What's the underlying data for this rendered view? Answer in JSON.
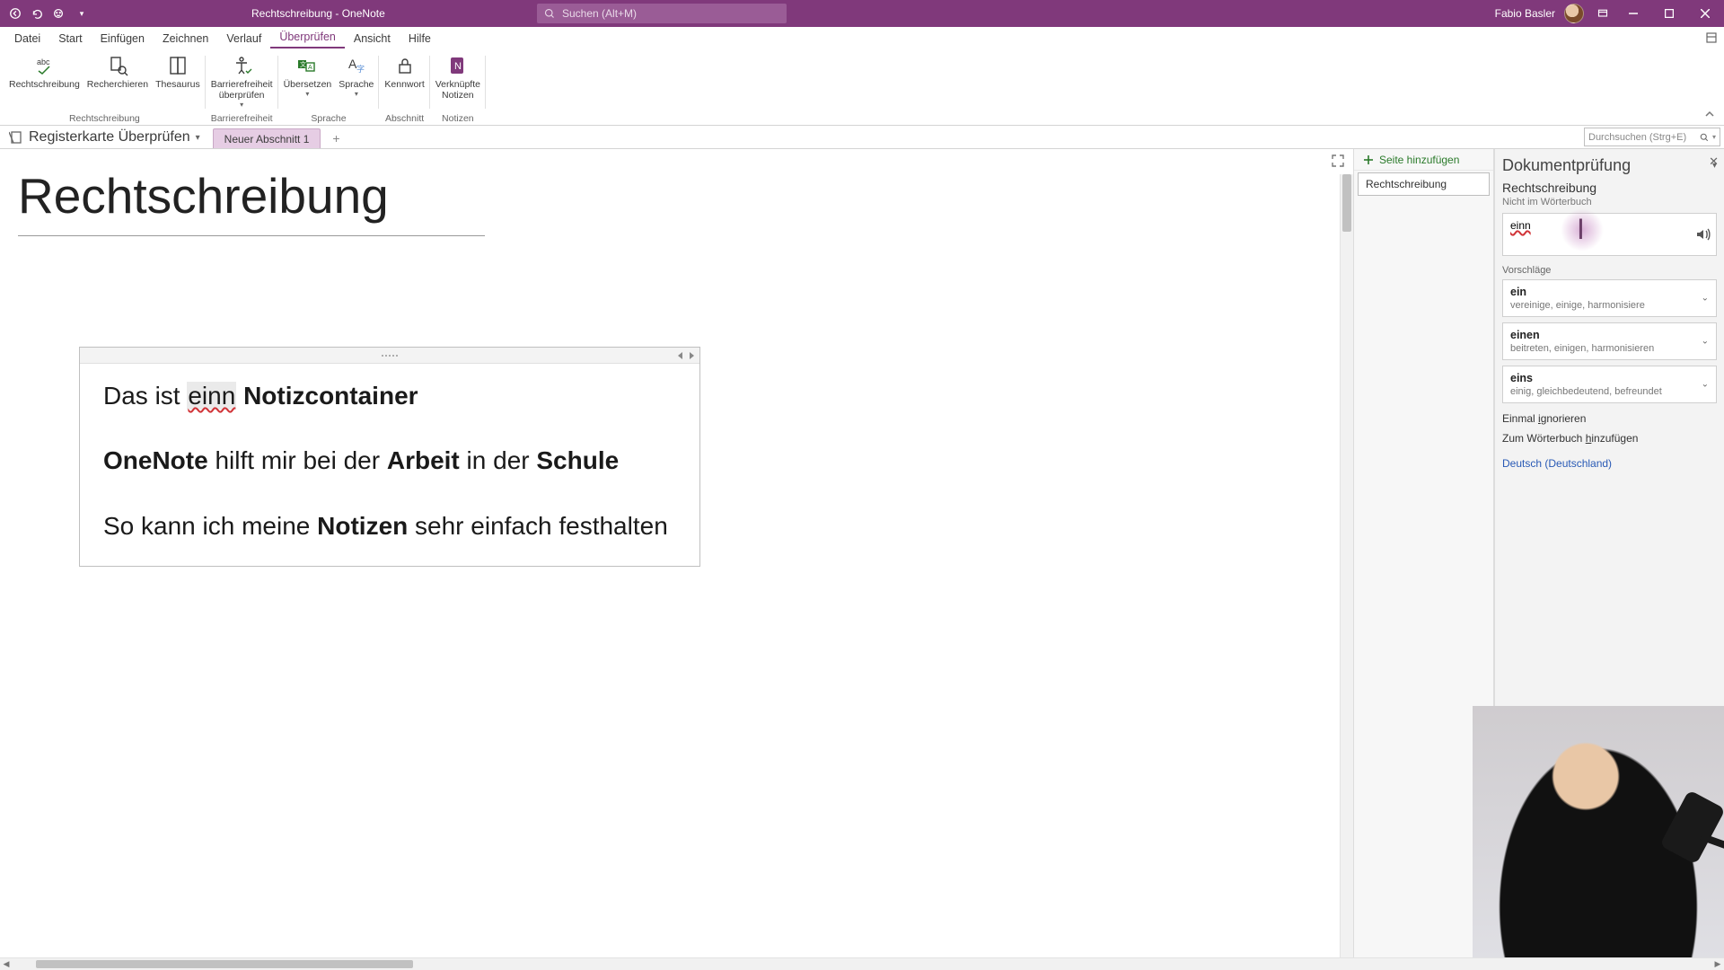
{
  "titlebar": {
    "doc_title": "Rechtschreibung  -  OneNote",
    "search_placeholder": "Suchen (Alt+M)",
    "username": "Fabio Basler"
  },
  "menu": {
    "items": [
      "Datei",
      "Start",
      "Einfügen",
      "Zeichnen",
      "Verlauf",
      "Überprüfen",
      "Ansicht",
      "Hilfe"
    ],
    "active_index": 5
  },
  "ribbon": {
    "groups": [
      {
        "label": "Rechtschreibung",
        "buttons": [
          {
            "name": "spelling",
            "label": "Rechtschreibung"
          },
          {
            "name": "research",
            "label": "Recherchieren"
          },
          {
            "name": "thesaurus",
            "label": "Thesaurus"
          }
        ]
      },
      {
        "label": "Barrierefreiheit",
        "buttons": [
          {
            "name": "accessibility",
            "label": "Barrierefreiheit\nüberprüfen",
            "dropdown": true
          }
        ]
      },
      {
        "label": "Sprache",
        "buttons": [
          {
            "name": "translate",
            "label": "Übersetzen",
            "dropdown": true
          },
          {
            "name": "language",
            "label": "Sprache",
            "dropdown": true
          }
        ]
      },
      {
        "label": "Abschnitt",
        "buttons": [
          {
            "name": "password",
            "label": "Kennwort"
          }
        ]
      },
      {
        "label": "Notizen",
        "buttons": [
          {
            "name": "linked-notes",
            "label": "Verknüpfte\nNotizen"
          }
        ]
      }
    ]
  },
  "notebook": {
    "name": "Registerkarte Überprüfen",
    "section_tab": "Neuer Abschnitt 1",
    "search_placeholder": "Durchsuchen (Strg+E)"
  },
  "page_list": {
    "add_label": "Seite hinzufügen",
    "items": [
      "Rechtschreibung"
    ]
  },
  "page": {
    "title": "Rechtschreibung",
    "lines": {
      "l1_pre": "Das ist ",
      "l1_err": "einn",
      "l1_post": " Notizcontainer",
      "l2_b1": "OneNote",
      "l2_t1": " hilft mir bei der ",
      "l2_b2": "Arbeit",
      "l2_t2": " in der ",
      "l2_b3": "Schule",
      "l3_t1": "So kann ich meine ",
      "l3_b1": "Notizen",
      "l3_t2": " sehr einfach festhalten"
    }
  },
  "editor": {
    "title": "Dokumentprüfung",
    "subtitle": "Rechtschreibung",
    "not_in_dict": "Nicht im Wörterbuch",
    "word": "einn",
    "suggestions_label": "Vorschläge",
    "suggestions": [
      {
        "word": "ein",
        "syn": "vereinige, einige, harmonisiere"
      },
      {
        "word": "einen",
        "syn": "beitreten, einigen, harmonisieren"
      },
      {
        "word": "eins",
        "syn": "einig, gleichbedeutend, befreundet"
      }
    ],
    "ignore_once": "Einmal ignorieren",
    "ignore_once_u": "I",
    "add_dict": "Zum Wörterbuch hinzufügen",
    "add_dict_u": "h",
    "language": "Deutsch (Deutschland)"
  }
}
